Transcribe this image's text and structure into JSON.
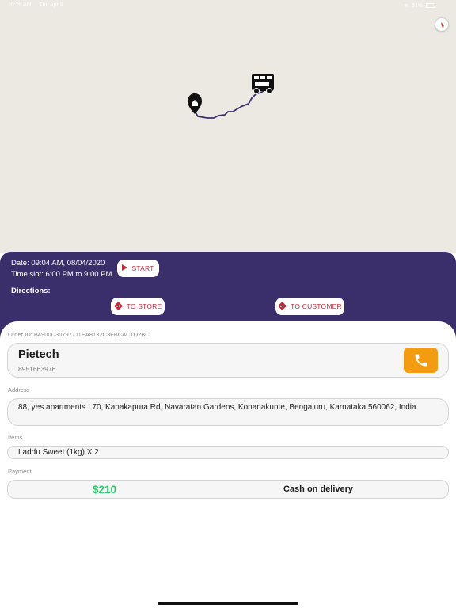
{
  "status_bar": {
    "time": "10:28 AM",
    "date": "Thu Apr 9",
    "battery": "81%"
  },
  "map": {
    "compass_icon": "compass-icon",
    "home_marker_icon": "home-pin-icon",
    "truck_icon": "delivery-truck-icon",
    "route_color": "#3b2f6b"
  },
  "order_panel": {
    "date": "Date: 09:04 AM, 08/04/2020",
    "time_slot": "Time slot: 6:00 PM to 9:00 PM",
    "start_label": "START",
    "directions_label": "Directions:",
    "to_store_label": "TO STORE",
    "to_customer_label": "TO CUSTOMER",
    "accent_color": "#c42a3a",
    "panel_color": "#3b2f6b"
  },
  "order": {
    "order_id": "Order ID: B4900D30797711EA8132C3FBCAC1D2BC",
    "customer_name": "Pietech",
    "customer_phone": "8951663976",
    "address_label": "Address",
    "address": "88, yes apartments , 70, Kanakapura Rd, Navaratan Gardens, Konanakunte, Bengaluru, Karnataka 560062, India",
    "items_label": "Items",
    "items": "Laddu Sweet (1kg) X 2",
    "payment_label": "Payment",
    "amount": "$210",
    "payment_mode": "Cash on delivery",
    "call_button_color": "#f39c12",
    "amount_color": "#2ecc71"
  }
}
